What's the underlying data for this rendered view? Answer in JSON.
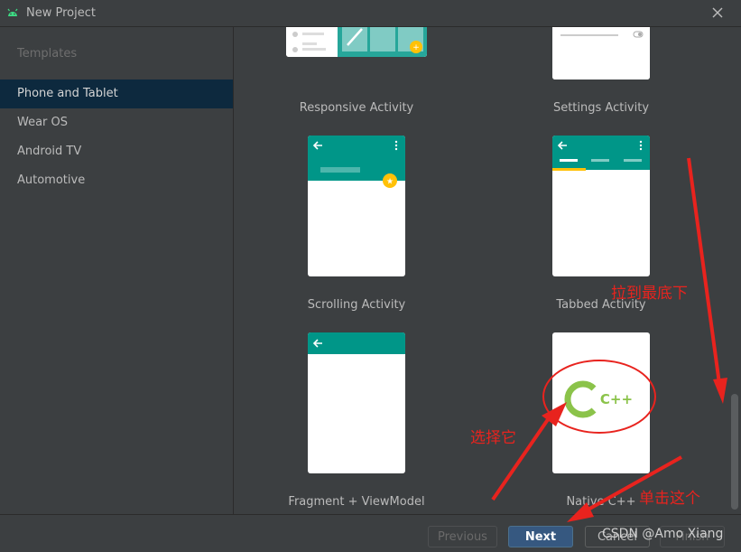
{
  "window": {
    "title": "New Project",
    "icon": "android-icon"
  },
  "sidebar": {
    "section_label": "Templates",
    "items": [
      {
        "label": "Phone and Tablet",
        "selected": true
      },
      {
        "label": "Wear OS",
        "selected": false
      },
      {
        "label": "Android TV",
        "selected": false
      },
      {
        "label": "Automotive",
        "selected": false
      }
    ]
  },
  "templates": [
    {
      "label": "Responsive Activity"
    },
    {
      "label": "Settings Activity"
    },
    {
      "label": "Scrolling Activity"
    },
    {
      "label": "Tabbed Activity"
    },
    {
      "label": "Fragment + ViewModel"
    },
    {
      "label": "Native C++",
      "logo_text": "C++"
    }
  ],
  "footer": {
    "previous_label": "Previous",
    "next_label": "Next",
    "cancel_label": "Cancel",
    "finish_label": "Finish"
  },
  "annotations": {
    "scroll_hint": "拉到最底下",
    "select_hint": "选择它",
    "click_hint": "单击这个"
  },
  "watermark": "CSDN @Amo Xiang",
  "colors": {
    "teal": "#009688",
    "teal_light": "#4db6ac",
    "accent": "#ffc107",
    "cpp_green": "#8bc34a",
    "annotation_red": "#e8231e",
    "selected_bg": "#0d293e",
    "primary_button": "#365880"
  }
}
